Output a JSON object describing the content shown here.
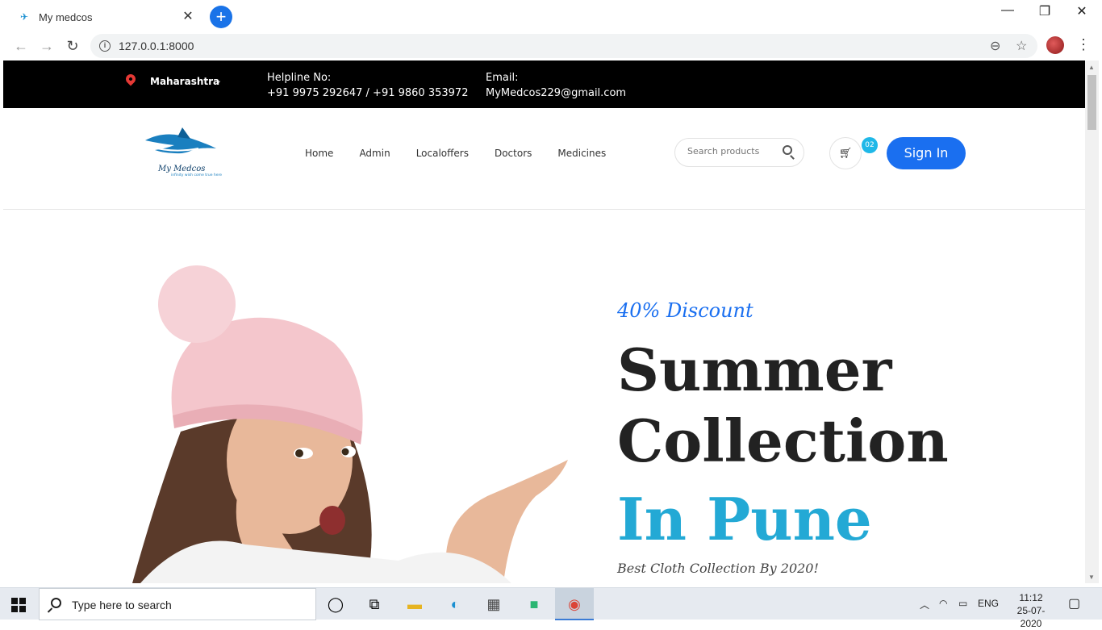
{
  "browser": {
    "tab_title": "My medcos",
    "url": "127.0.0.1:8000"
  },
  "topbar": {
    "location": "Maharashtra",
    "helpline_label": "Helpline No:",
    "helpline_numbers": "+91 9975 292647 / +91 9860 353972",
    "email_label": "Email:",
    "email_value": "MyMedcos229@gmail.com"
  },
  "header": {
    "logo_title": "My Medcos",
    "logo_tagline": "infinity wish come true here",
    "nav": [
      "Home",
      "Admin",
      "Localoffers",
      "Doctors",
      "Medicines"
    ],
    "search_placeholder": "Search products",
    "cart_count": "02",
    "signin_label": "Sign In"
  },
  "hero": {
    "discount": "40% Discount",
    "headline_line1": "Summer",
    "headline_line2": "Collection",
    "headline_accent": "In Pune",
    "subline": "Best Cloth Collection By 2020!"
  },
  "taskbar": {
    "search_placeholder": "Type here to search",
    "language": "ENG",
    "time": "11:12",
    "date": "25-07-2020"
  },
  "colors": {
    "brand_blue": "#1a6ff0",
    "accent_cyan": "#23a9d5",
    "topbar_bg": "#000000"
  }
}
